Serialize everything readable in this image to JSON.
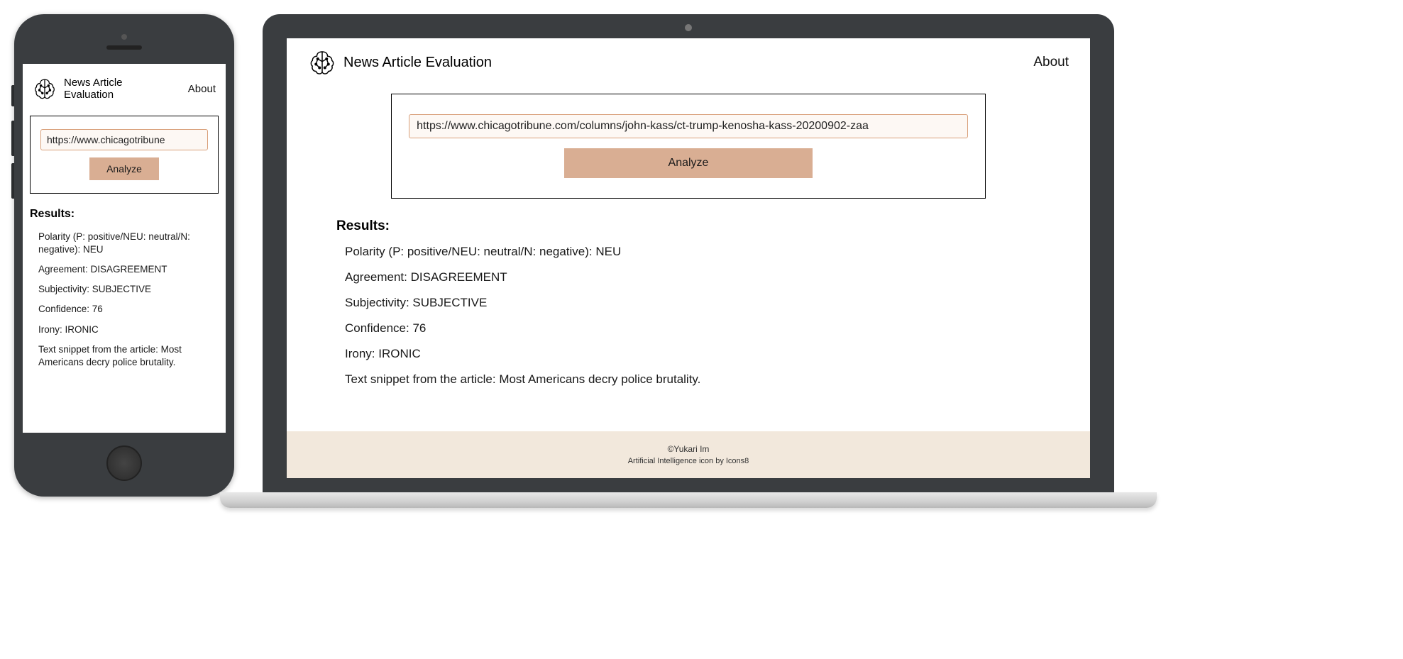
{
  "app": {
    "title": "News Article Evaluation",
    "about_label": "About"
  },
  "input": {
    "url_value_full": "https://www.chicagotribune.com/columns/john-kass/ct-trump-kenosha-kass-20200902-zaa",
    "url_value_short": "https://www.chicagotribune",
    "analyze_label": "Analyze"
  },
  "results": {
    "heading": "Results:",
    "polarity_line": "Polarity (P: positive/NEU: neutral/N: negative): NEU",
    "agreement_line": "Agreement: DISAGREEMENT",
    "subjectivity_line": "Subjectivity: SUBJECTIVE",
    "confidence_line": "Confidence: 76",
    "irony_line": "Irony: IRONIC",
    "snippet_line": "Text snippet from the article: Most Americans decry police brutality."
  },
  "footer": {
    "copyright": "©Yukari Im",
    "attribution": "Artificial Intelligence icon by Icons8"
  },
  "icons": {
    "brain": "brain-icon"
  }
}
